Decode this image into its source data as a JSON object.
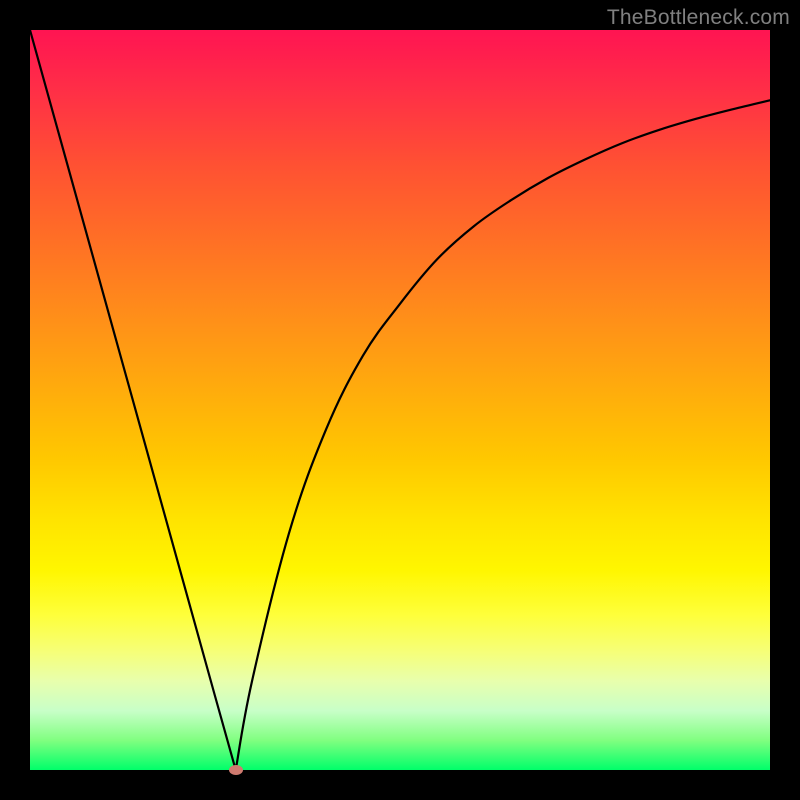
{
  "watermark": "TheBottleneck.com",
  "colors": {
    "frame": "#000000",
    "marker": "#cf7a6f",
    "curve": "#000000"
  },
  "chart_data": {
    "type": "line",
    "title": "",
    "xlabel": "",
    "ylabel": "",
    "xlim": [
      0,
      100
    ],
    "ylim": [
      0,
      100
    ],
    "series": [
      {
        "name": "left-branch",
        "x": [
          0,
          5,
          10,
          15,
          20,
          25,
          27.8
        ],
        "values": [
          100,
          82,
          64,
          46,
          28,
          10,
          0
        ]
      },
      {
        "name": "right-branch",
        "x": [
          27.8,
          30,
          35,
          40,
          45,
          50,
          55,
          60,
          65,
          70,
          75,
          80,
          85,
          90,
          95,
          100
        ],
        "values": [
          0,
          12,
          32,
          46,
          56,
          63,
          69,
          73.5,
          77,
          80,
          82.5,
          84.7,
          86.5,
          88,
          89.3,
          90.5
        ]
      }
    ],
    "marker": {
      "x": 27.8,
      "y": 0
    },
    "gradient_stops": [
      {
        "pct": 0,
        "color": "#ff1452"
      },
      {
        "pct": 50,
        "color": "#ffaa0d"
      },
      {
        "pct": 80,
        "color": "#feff3a"
      },
      {
        "pct": 100,
        "color": "#00ff6a"
      }
    ]
  }
}
